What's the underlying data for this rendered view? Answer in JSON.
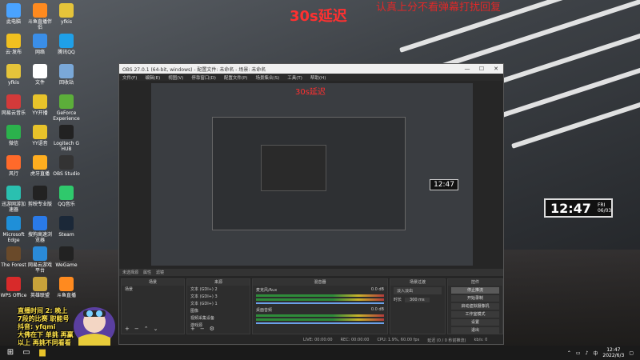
{
  "overlay": {
    "delay_text": "30s延迟",
    "notice_text": "认真上分不看弹幕打扰回复"
  },
  "desktop_icons": [
    {
      "label": "此电脑",
      "color": "#4aa3ff"
    },
    {
      "label": "斗鱼直播伴侣",
      "color": "#ff8a1f"
    },
    {
      "label": "yfkis",
      "color": "#e5c43a"
    },
    {
      "label": "云·发布",
      "color": "#f0c020"
    },
    {
      "label": "网络",
      "color": "#3a8ee8"
    },
    {
      "label": "腾讯QQ",
      "color": "#1fa0e8"
    },
    {
      "label": "yfkis",
      "color": "#e5c43a"
    },
    {
      "label": "文件",
      "color": "#ffffff"
    },
    {
      "label": "回收站",
      "color": "#7aa8d8"
    },
    {
      "label": "网易云音乐",
      "color": "#d33a3a"
    },
    {
      "label": "YY开播",
      "color": "#e8c32a"
    },
    {
      "label": "GeForce Experience",
      "color": "#5cae3a"
    },
    {
      "label": "微信",
      "color": "#2bb24c"
    },
    {
      "label": "YY语音",
      "color": "#e8c32a"
    },
    {
      "label": "Logitech G HUB",
      "color": "#222222"
    },
    {
      "label": "风行",
      "color": "#ff6a2a"
    },
    {
      "label": "虎牙直播",
      "color": "#ffae1f"
    },
    {
      "label": "OBS Studio",
      "color": "#333333"
    },
    {
      "label": "迅游网游加速器",
      "color": "#2ac0b0"
    },
    {
      "label": "剪映专业版",
      "color": "#222222"
    },
    {
      "label": "QQ音乐",
      "color": "#2fc96c"
    },
    {
      "label": "Microsoft Edge",
      "color": "#1f8fd8"
    },
    {
      "label": "搜狗高速浏览器",
      "color": "#2a7ae8"
    },
    {
      "label": "Steam",
      "color": "#1b2838"
    },
    {
      "label": "The Forest",
      "color": "#6a4a2a"
    },
    {
      "label": "网易云游戏平台",
      "color": "#2a8ad8"
    },
    {
      "label": "WeGame",
      "color": "#222222"
    },
    {
      "label": "WPS Office",
      "color": "#d82a2a"
    },
    {
      "label": "英雄联盟",
      "color": "#c8a23a"
    },
    {
      "label": "斗鱼直播",
      "color": "#ff8a1f"
    }
  ],
  "obs": {
    "title": "OBS 27.0.1 (64-bit, windows) - 配置文件: 未命名 - 场景: 未命名",
    "menu": [
      "文件(F)",
      "编辑(E)",
      "视图(V)",
      "停靠窗口(D)",
      "配置文件(P)",
      "场景集合(S)",
      "工具(T)",
      "帮助(H)"
    ],
    "window_controls": [
      "—",
      "☐",
      "✕"
    ],
    "source_bar": [
      "未选择源",
      "属性",
      "滤镜"
    ],
    "scenes_header": "场景",
    "scenes": [
      "场景"
    ],
    "sources_header": "来源",
    "sources": [
      "文本 (GDI+) 2",
      "文本 (GDI+) 3",
      "文本 (GDI+) 1",
      "图像",
      "视频采集设备",
      "游戏源"
    ],
    "mixer_header": "混音器",
    "mixer": [
      {
        "name": "麦克风/Aux",
        "db": "0.0 dB"
      },
      {
        "name": "桌面音频",
        "db": "0.0 dB"
      }
    ],
    "transition_header": "场景过渡",
    "transition_type": "淡入淡出",
    "transition_duration_label": "时长",
    "transition_duration": "300 ms",
    "controls_header": "控件",
    "controls": [
      "停止推流",
      "开始录制",
      "启动虚拟摄像机",
      "工作室模式",
      "设置",
      "退出"
    ],
    "status": {
      "live": "LIVE: 00:00:00",
      "rec": "REC: 00:00:00",
      "cpu": "CPU: 1.9%, 60.00 fps",
      "dropped": "延迟 (0 / 0 秒前推流)",
      "kbps": "kb/s: 0"
    },
    "preview_delay": "30s延迟",
    "preview_clock": "12:47"
  },
  "clock_widget": {
    "time": "12:47",
    "day": "FRI",
    "date": "06/03"
  },
  "streamer_overlay": {
    "line1": "直播时间 2: 晚上",
    "line2": "7段的比赛 职能号",
    "line3": "抖音: yfqmi",
    "line4": "大佛在下 单挑 再赢",
    "line5": "以上 再挑不同看看"
  },
  "taskbar": {
    "time": "12:47",
    "date": "2022/6/3",
    "tray_lang": "中",
    "colors": {
      "bg": "#1a1a1a"
    }
  }
}
